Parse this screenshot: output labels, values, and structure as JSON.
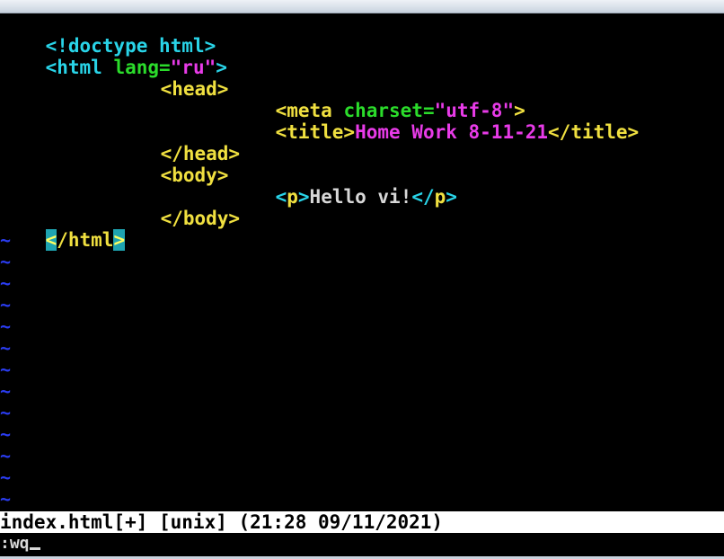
{
  "editor": {
    "lines": [
      {
        "t1": "<!doctype html>"
      },
      {
        "t1": "<html",
        "t2": " lang=",
        "t3": "\"ru\"",
        "t4": ">"
      },
      {
        "t1": "<head>"
      },
      {
        "t1": "<meta",
        "t2": " charset=",
        "t3": "\"utf-8\"",
        "t4": ">"
      },
      {
        "t1": "<title>",
        "t2": "Home Work 8-11-21",
        "t3": "</title>"
      },
      {
        "t1": "</head>"
      },
      {
        "t1": "<body>"
      },
      {
        "t1": "<",
        "t2": "p",
        "t3": ">",
        "t4": "Hello vi!",
        "t5": "</",
        "t6": "p",
        "t7": ">"
      },
      {
        "t1": "</body>"
      },
      {
        "t1": "<",
        "t2": "/html",
        "t3": ">"
      }
    ],
    "empty_line_marker": "~"
  },
  "statusline": {
    "text": "index.html[+] [unix] (21:28 09/11/2021)"
  },
  "commandline": {
    "text": ":wq"
  },
  "colors": {
    "background": "#000000",
    "tag": "#29d4e8",
    "attribute": "#2bdc2b",
    "string": "#e83be8",
    "keyword": "#f0e040",
    "text": "#d8d8d8",
    "tilde": "#2a3cf0"
  }
}
